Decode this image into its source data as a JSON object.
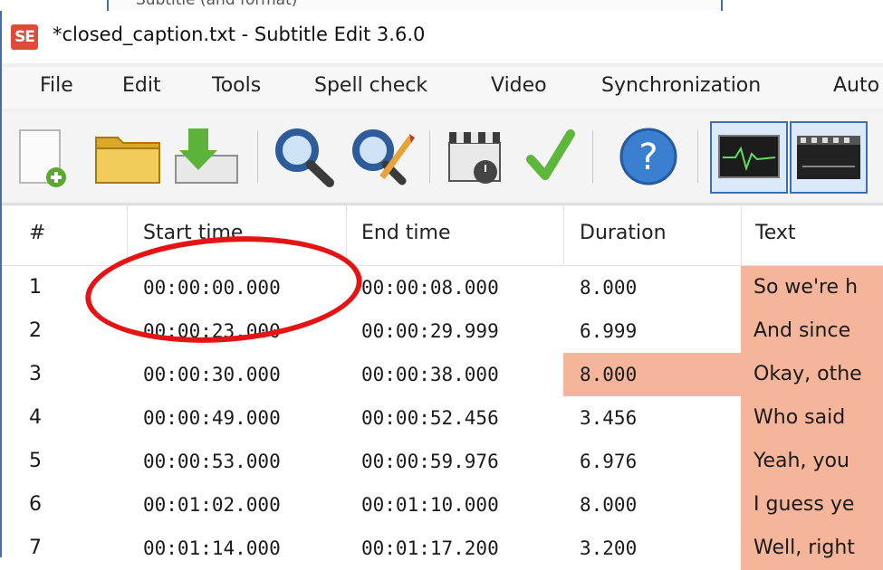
{
  "background_window": {
    "partial_text": "Subtitle (and format)"
  },
  "window": {
    "icon_text": "SE",
    "title": "*closed_caption.txt - Subtitle Edit 3.6.0",
    "accent_color": "#3d6db5"
  },
  "menu": {
    "items": [
      "File",
      "Edit",
      "Tools",
      "Spell check",
      "Video",
      "Synchronization",
      "Auto"
    ]
  },
  "toolbar": {
    "buttons": [
      "new-file-icon",
      "open-folder-icon",
      "save-download-icon",
      "find-icon",
      "replace-icon",
      "visual-sync-icon",
      "spell-check-icon",
      "help-icon",
      "waveform-icon",
      "video-player-icon"
    ]
  },
  "grid": {
    "headers": {
      "num": "#",
      "start": "Start time",
      "end": "End time",
      "duration": "Duration",
      "text": "Text"
    },
    "highlight_color": "#f5b59a",
    "rows": [
      {
        "num": "1",
        "start": "00:00:00.000",
        "end": "00:00:08.000",
        "duration": "8.000",
        "text": "So we're h",
        "duration_highlight": false,
        "text_highlight": true
      },
      {
        "num": "2",
        "start": "00:00:23.000",
        "end": "00:00:29.999",
        "duration": "6.999",
        "text": "And since",
        "duration_highlight": false,
        "text_highlight": true
      },
      {
        "num": "3",
        "start": "00:00:30.000",
        "end": "00:00:38.000",
        "duration": "8.000",
        "text": "Okay, othe",
        "duration_highlight": true,
        "text_highlight": true
      },
      {
        "num": "4",
        "start": "00:00:49.000",
        "end": "00:00:52.456",
        "duration": "3.456",
        "text": "Who said",
        "duration_highlight": false,
        "text_highlight": true
      },
      {
        "num": "5",
        "start": "00:00:53.000",
        "end": "00:00:59.976",
        "duration": "6.976",
        "text": "Yeah, you",
        "duration_highlight": false,
        "text_highlight": true
      },
      {
        "num": "6",
        "start": "00:01:02.000",
        "end": "00:01:10.000",
        "duration": "8.000",
        "text": "I guess ye",
        "duration_highlight": false,
        "text_highlight": true
      },
      {
        "num": "7",
        "start": "00:01:14.000",
        "end": "00:01:17.200",
        "duration": "3.200",
        "text": "Well, right",
        "duration_highlight": false,
        "text_highlight": true
      }
    ]
  },
  "annotation": {
    "shape": "red-oval",
    "color": "#e51414",
    "target": "row 1 start time"
  }
}
